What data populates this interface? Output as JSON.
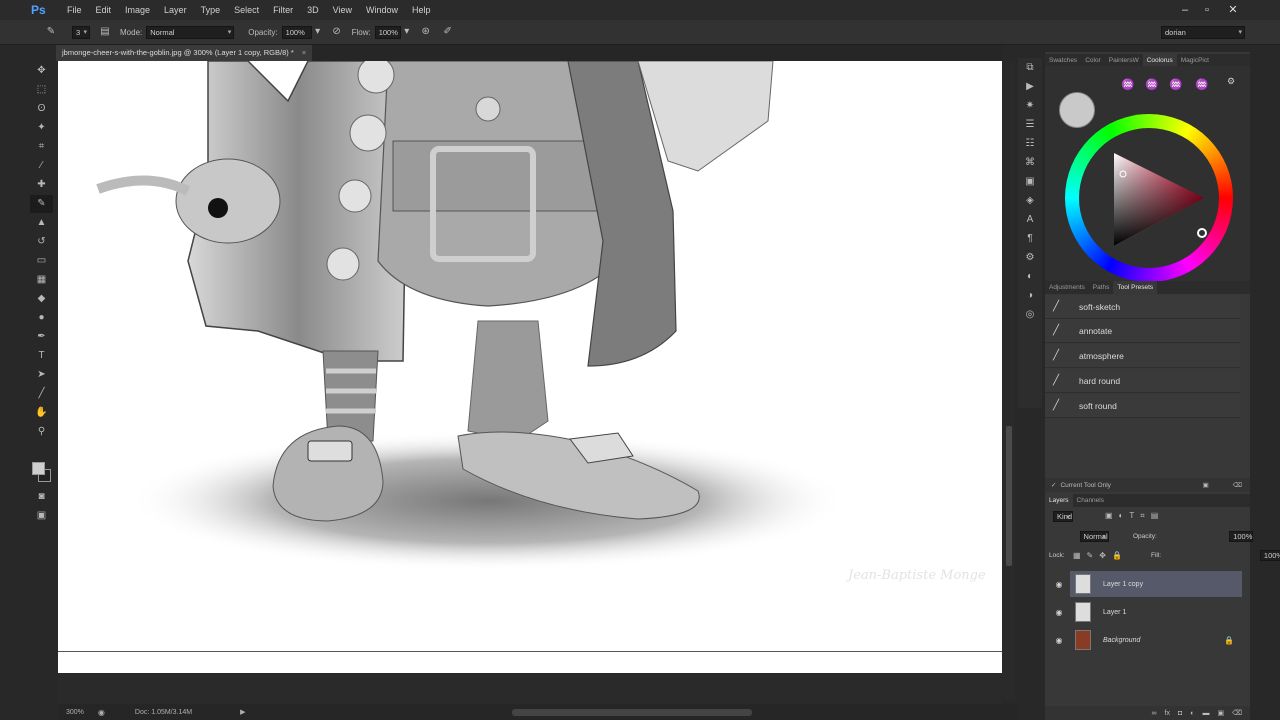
{
  "app": {
    "logo": "Ps"
  },
  "menu": [
    "File",
    "Edit",
    "Image",
    "Layer",
    "Type",
    "Select",
    "Filter",
    "3D",
    "View",
    "Window",
    "Help"
  ],
  "window_controls": [
    "–",
    "▫",
    "✕"
  ],
  "options": {
    "brush_size": "3",
    "mode_label": "Mode:",
    "mode_value": "Normal",
    "opacity_label": "Opacity:",
    "opacity_value": "100%",
    "flow_label": "Flow:",
    "flow_value": "100%",
    "workspace": "dorian"
  },
  "document": {
    "tab_title": "jbmonge-cheer-s-with-the-goblin.jpg @ 300% (Layer 1 copy, RGB/8) *",
    "close": "×",
    "signature": "Jean-Baptiste Monge"
  },
  "status": {
    "zoom": "300%",
    "doc": "Doc: 1.05M/3.14M"
  },
  "color_panel": {
    "tabs": [
      "Swatches",
      "Color",
      "PaintersW",
      "Coolorus",
      "MagicPict"
    ],
    "active_tab": "Coolorus"
  },
  "presets_panel": {
    "tabs": [
      "Adjustments",
      "Paths",
      "Tool Presets"
    ],
    "active_tab": "Tool Presets",
    "items": [
      "soft-sketch",
      "annotate",
      "atmosphere",
      "hard round",
      "soft round"
    ],
    "current_tool_only": "Current Tool Only"
  },
  "layers_panel": {
    "tabs": [
      "Layers",
      "Channels"
    ],
    "active_tab": "Layers",
    "kind": "Kind",
    "blend_mode": "Normal",
    "opacity_label": "Opacity:",
    "opacity_value": "100%",
    "lock_label": "Lock:",
    "fill_label": "Fill:",
    "fill_value": "100%",
    "layers": [
      {
        "name": "Layer 1 copy",
        "selected": true
      },
      {
        "name": "Layer 1",
        "selected": false
      },
      {
        "name": "Background",
        "selected": false,
        "locked": true
      }
    ]
  },
  "colors": {
    "accent_selected_layer": "#55596a",
    "foreground": "#cfcfcf",
    "background": "#222222"
  }
}
